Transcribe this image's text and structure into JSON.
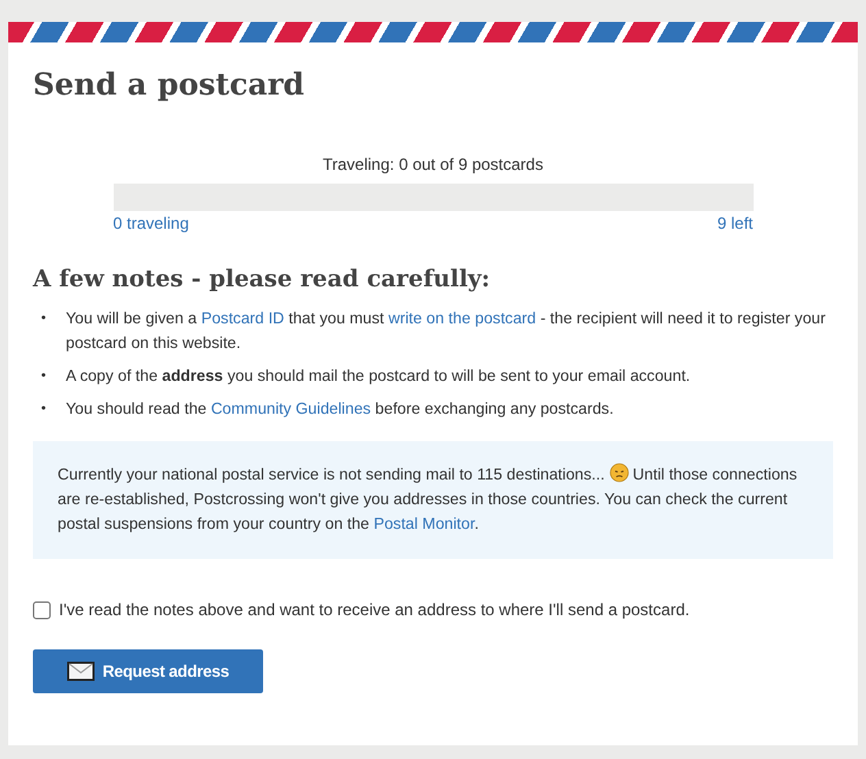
{
  "title": "Send a postcard",
  "progress": {
    "caption": "Traveling: 0 out of 9 postcards",
    "level": 0,
    "left_label": "0 traveling",
    "right_label": "9 left"
  },
  "notes_heading": "A few notes - please read carefully:",
  "notes": [
    {
      "marker": "•",
      "parts": [
        {
          "kind": "plain",
          "text": "You will be given a "
        },
        {
          "kind": "link",
          "text": "Postcard ID"
        },
        {
          "kind": "plain",
          "text": " that you must "
        },
        {
          "kind": "link",
          "text": "write on the postcard"
        },
        {
          "kind": "plain",
          "text": " - the recipient will need it to register your postcard on this website."
        }
      ]
    },
    {
      "marker": "•",
      "parts": [
        {
          "kind": "plain",
          "text": "A copy of the "
        },
        {
          "kind": "bold",
          "text": "address"
        },
        {
          "kind": "plain",
          "text": " you should mail the postcard to will be sent to your email account."
        }
      ]
    },
    {
      "marker": "•",
      "parts": [
        {
          "kind": "plain",
          "text": "You should read the "
        },
        {
          "kind": "link",
          "text": "Community Guidelines"
        },
        {
          "kind": "plain",
          "text": " before exchanging any postcards."
        }
      ]
    }
  ],
  "notice": [
    {
      "kind": "plain",
      "text": "Currently your national postal service is not sending mail to 115 destinations... "
    },
    {
      "kind": "emoji"
    },
    {
      "kind": "plain",
      "text": " Until those connections are re-established, Postcrossing won't give you addresses in those countries. You can check the current postal suspensions from your country on the "
    },
    {
      "kind": "link",
      "text": "Postal Monitor"
    },
    {
      "kind": "plain",
      "text": "."
    }
  ],
  "agreement": {
    "label": "I've read the notes above and want to receive an address to where I'll send a postcard.",
    "checked": false
  },
  "button": "Request address"
}
